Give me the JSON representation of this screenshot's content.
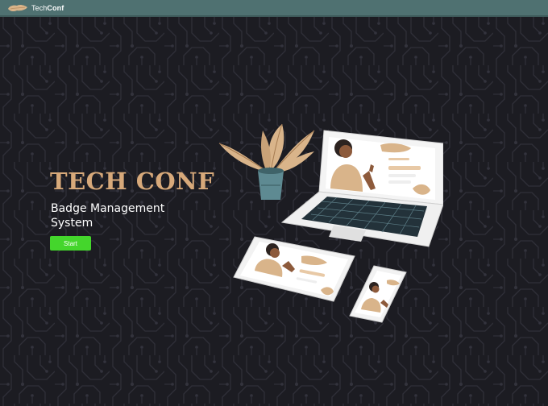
{
  "navbar": {
    "brand_light": "Tech",
    "brand_bold": "Conf",
    "logo_icon": "cloud-brush-logo",
    "background": "#4f7171"
  },
  "hero": {
    "title": "TECH CONF",
    "subtitle": "Badge Management System",
    "start_label": "Start",
    "title_color": "#d7a97a",
    "button_color": "#44d62c"
  },
  "illustration": {
    "icon": "video-conference-devices-illustration"
  },
  "background": {
    "pattern": "circuit-board",
    "color": "#1c1c22"
  }
}
